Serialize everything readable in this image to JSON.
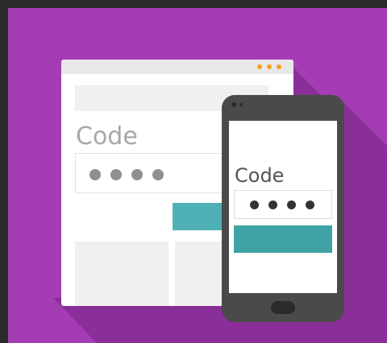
{
  "browser": {
    "code_label": "Code",
    "code_digits": 4
  },
  "phone": {
    "code_label": "Code",
    "code_digits": 4
  },
  "colors": {
    "background": "#a43cb4",
    "frame": "#2b2b2b",
    "accent_teal": "#4fb0b6",
    "window_dots": "#f4a020"
  }
}
